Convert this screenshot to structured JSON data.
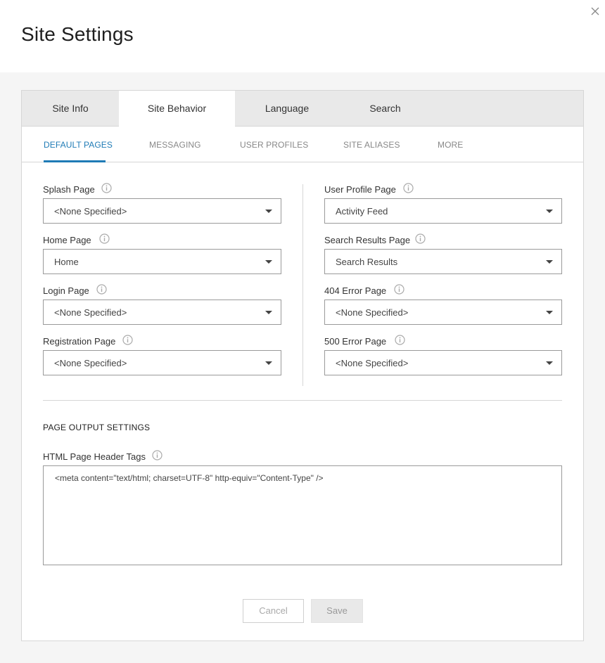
{
  "page": {
    "title": "Site Settings"
  },
  "tabs": [
    {
      "label": "Site Info"
    },
    {
      "label": "Site Behavior",
      "active": true
    },
    {
      "label": "Language"
    },
    {
      "label": "Search"
    }
  ],
  "subtabs": [
    {
      "label": "DEFAULT PAGES",
      "active": true
    },
    {
      "label": "MESSAGING"
    },
    {
      "label": "USER PROFILES"
    },
    {
      "label": "SITE ALIASES"
    },
    {
      "label": "MORE"
    }
  ],
  "left_fields": [
    {
      "label": "Splash Page",
      "value": "<None Specified>"
    },
    {
      "label": "Home Page",
      "value": "Home"
    },
    {
      "label": "Login Page",
      "value": "<None Specified>"
    },
    {
      "label": "Registration Page",
      "value": "<None Specified>"
    }
  ],
  "right_fields": [
    {
      "label": "User Profile Page",
      "value": "Activity Feed"
    },
    {
      "label": "Search Results Page",
      "value": "Search Results"
    },
    {
      "label": "404 Error Page",
      "value": "<None Specified>"
    },
    {
      "label": "500 Error Page",
      "value": "<None Specified>"
    }
  ],
  "output": {
    "section_title": "PAGE OUTPUT SETTINGS",
    "header_tags_label": "HTML Page Header Tags",
    "header_tags_value": "<meta content=\"text/html; charset=UTF-8\" http-equiv=\"Content-Type\" />"
  },
  "buttons": {
    "cancel": "Cancel",
    "save": "Save"
  },
  "colors": {
    "accent": "#1f7bb6",
    "tab_bar": "#e9e9e9",
    "background": "#f5f5f5"
  },
  "icons": {
    "close": "close-icon",
    "info": "info-icon",
    "dropdown": "chevron-down-icon"
  }
}
